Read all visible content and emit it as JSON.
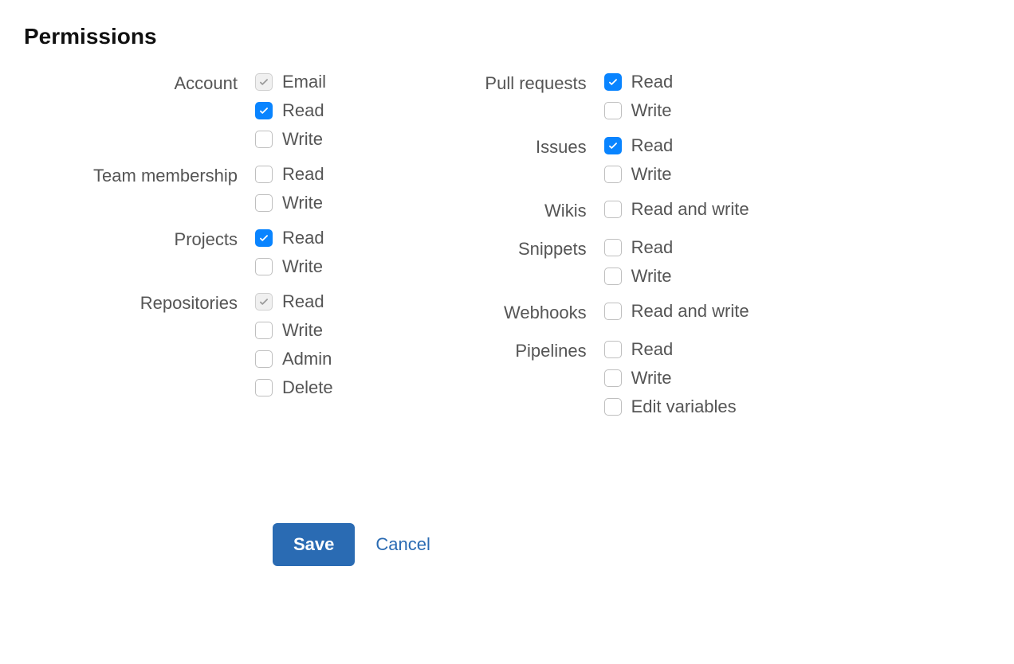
{
  "title": "Permissions",
  "buttons": {
    "save": "Save",
    "cancel": "Cancel"
  },
  "left": [
    {
      "label": "Account",
      "options": [
        {
          "label": "Email",
          "state": "checked-disabled"
        },
        {
          "label": "Read",
          "state": "checked"
        },
        {
          "label": "Write",
          "state": "unchecked"
        }
      ]
    },
    {
      "label": "Team membership",
      "options": [
        {
          "label": "Read",
          "state": "unchecked"
        },
        {
          "label": "Write",
          "state": "unchecked"
        }
      ]
    },
    {
      "label": "Projects",
      "options": [
        {
          "label": "Read",
          "state": "checked"
        },
        {
          "label": "Write",
          "state": "unchecked"
        }
      ]
    },
    {
      "label": "Repositories",
      "options": [
        {
          "label": "Read",
          "state": "checked-disabled"
        },
        {
          "label": "Write",
          "state": "unchecked"
        },
        {
          "label": "Admin",
          "state": "unchecked"
        },
        {
          "label": "Delete",
          "state": "unchecked"
        }
      ]
    }
  ],
  "right": [
    {
      "label": "Pull requests",
      "options": [
        {
          "label": "Read",
          "state": "checked"
        },
        {
          "label": "Write",
          "state": "unchecked"
        }
      ]
    },
    {
      "label": "Issues",
      "options": [
        {
          "label": "Read",
          "state": "checked"
        },
        {
          "label": "Write",
          "state": "unchecked"
        }
      ]
    },
    {
      "label": "Wikis",
      "options": [
        {
          "label": "Read and write",
          "state": "unchecked"
        }
      ]
    },
    {
      "label": "Snippets",
      "options": [
        {
          "label": "Read",
          "state": "unchecked"
        },
        {
          "label": "Write",
          "state": "unchecked"
        }
      ]
    },
    {
      "label": "Webhooks",
      "options": [
        {
          "label": "Read and write",
          "state": "unchecked"
        }
      ]
    },
    {
      "label": "Pipelines",
      "options": [
        {
          "label": "Read",
          "state": "unchecked"
        },
        {
          "label": "Write",
          "state": "unchecked"
        },
        {
          "label": "Edit variables",
          "state": "unchecked"
        }
      ]
    }
  ]
}
